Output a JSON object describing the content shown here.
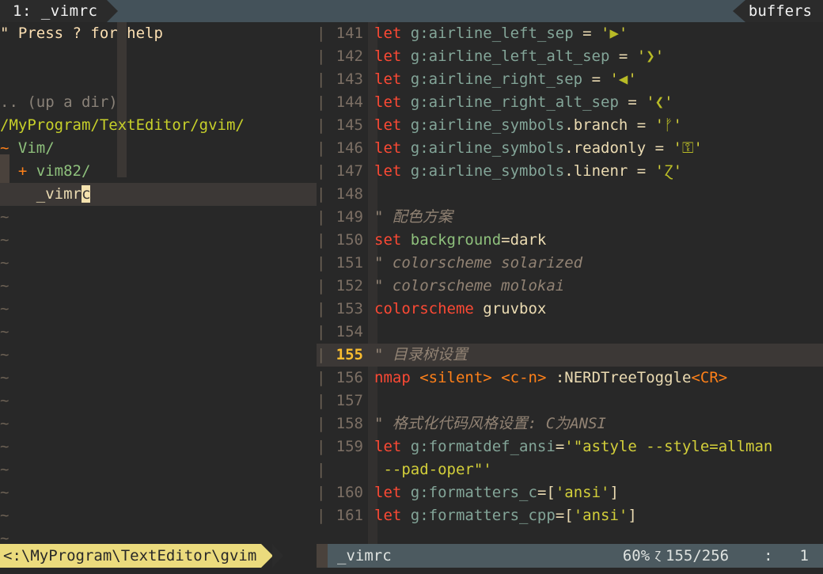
{
  "tabline": {
    "active_tab": "1: _vimrc",
    "right_label": "buffers"
  },
  "nerdtree": {
    "help_line": "\" Press ? for help",
    "blank_line": "",
    "up_dir": ".. (up a dir)",
    "root_path": "/MyProgram/TextEditor/gvim/",
    "nodes": [
      {
        "marker": "~",
        "label": " Vim/"
      },
      {
        "marker": "+",
        "label": " vim82/"
      }
    ],
    "selected_file": "_vimrc",
    "selected_file_head": "_vimr",
    "selected_file_cursor": "c",
    "tilde_char": "~",
    "tilde_count": 15
  },
  "code": {
    "separator": "|",
    "lines": [
      {
        "num": "141",
        "segments": [
          {
            "t": "let",
            "c": "kw"
          },
          {
            "t": " ",
            "c": "plain"
          },
          {
            "t": "g:airline_left_sep",
            "c": "ident"
          },
          {
            "t": " = ",
            "c": "op"
          },
          {
            "t": "'",
            "c": "str"
          },
          {
            "t": "▶",
            "c": "pglyph"
          },
          {
            "t": "'",
            "c": "str"
          }
        ]
      },
      {
        "num": "142",
        "segments": [
          {
            "t": "let",
            "c": "kw"
          },
          {
            "t": " ",
            "c": "plain"
          },
          {
            "t": "g:airline_left_alt_sep",
            "c": "ident"
          },
          {
            "t": " = ",
            "c": "op"
          },
          {
            "t": "'",
            "c": "str"
          },
          {
            "t": "❯",
            "c": "pglyph"
          },
          {
            "t": "'",
            "c": "str"
          }
        ]
      },
      {
        "num": "143",
        "segments": [
          {
            "t": "let",
            "c": "kw"
          },
          {
            "t": " ",
            "c": "plain"
          },
          {
            "t": "g:airline_right_sep",
            "c": "ident"
          },
          {
            "t": " = ",
            "c": "op"
          },
          {
            "t": "'",
            "c": "str"
          },
          {
            "t": "◀",
            "c": "pglyph"
          },
          {
            "t": "'",
            "c": "str"
          }
        ]
      },
      {
        "num": "144",
        "segments": [
          {
            "t": "let",
            "c": "kw"
          },
          {
            "t": " ",
            "c": "plain"
          },
          {
            "t": "g:airline_right_alt_sep",
            "c": "ident"
          },
          {
            "t": " = ",
            "c": "op"
          },
          {
            "t": "'",
            "c": "str"
          },
          {
            "t": "❮",
            "c": "pglyph"
          },
          {
            "t": "'",
            "c": "str"
          }
        ]
      },
      {
        "num": "145",
        "segments": [
          {
            "t": "let",
            "c": "kw"
          },
          {
            "t": " ",
            "c": "plain"
          },
          {
            "t": "g:airline_symbols",
            "c": "ident"
          },
          {
            "t": ".branch",
            "c": "plain"
          },
          {
            "t": " = ",
            "c": "op"
          },
          {
            "t": "'",
            "c": "str"
          },
          {
            "t": "ᚠ",
            "c": "pglyph"
          },
          {
            "t": "'",
            "c": "str"
          }
        ]
      },
      {
        "num": "146",
        "segments": [
          {
            "t": "let",
            "c": "kw"
          },
          {
            "t": " ",
            "c": "plain"
          },
          {
            "t": "g:airline_symbols",
            "c": "ident"
          },
          {
            "t": ".readonly",
            "c": "plain"
          },
          {
            "t": " = ",
            "c": "op"
          },
          {
            "t": "'",
            "c": "str"
          },
          {
            "t": "⚿",
            "c": "pglyph"
          },
          {
            "t": "'",
            "c": "str"
          }
        ]
      },
      {
        "num": "147",
        "segments": [
          {
            "t": "let",
            "c": "kw"
          },
          {
            "t": " ",
            "c": "plain"
          },
          {
            "t": "g:airline_symbols",
            "c": "ident"
          },
          {
            "t": ".linenr",
            "c": "plain"
          },
          {
            "t": " = ",
            "c": "op"
          },
          {
            "t": "'",
            "c": "str"
          },
          {
            "t": "Ɀ",
            "c": "pglyph"
          },
          {
            "t": "'",
            "c": "str"
          }
        ]
      },
      {
        "num": "148",
        "segments": []
      },
      {
        "num": "149",
        "segments": [
          {
            "t": "\" 配色方案",
            "c": "cmt"
          }
        ]
      },
      {
        "num": "150",
        "segments": [
          {
            "t": "set",
            "c": "kw"
          },
          {
            "t": " ",
            "c": "plain"
          },
          {
            "t": "background",
            "c": "opt"
          },
          {
            "t": "=dark",
            "c": "plain"
          }
        ]
      },
      {
        "num": "151",
        "segments": [
          {
            "t": "\" colorscheme solarized",
            "c": "cmt"
          }
        ]
      },
      {
        "num": "152",
        "segments": [
          {
            "t": "\" colorscheme molokai",
            "c": "cmt"
          }
        ]
      },
      {
        "num": "153",
        "segments": [
          {
            "t": "colorscheme",
            "c": "kw"
          },
          {
            "t": " ",
            "c": "plain"
          },
          {
            "t": "gruvbox",
            "c": "plain"
          }
        ]
      },
      {
        "num": "154",
        "segments": []
      },
      {
        "num": "155",
        "cursorline": true,
        "segments": [
          {
            "t": "\" 目录树设置",
            "c": "cmt"
          }
        ]
      },
      {
        "num": "156",
        "segments": [
          {
            "t": "nmap",
            "c": "kw-o"
          },
          {
            "t": " ",
            "c": "plain"
          },
          {
            "t": "<silent>",
            "c": "special"
          },
          {
            "t": " ",
            "c": "plain"
          },
          {
            "t": "<c-n>",
            "c": "special"
          },
          {
            "t": " ",
            "c": "plain"
          },
          {
            "t": ":NERDTreeToggle",
            "c": "plain"
          },
          {
            "t": "<CR>",
            "c": "special"
          }
        ]
      },
      {
        "num": "157",
        "segments": []
      },
      {
        "num": "158",
        "segments": [
          {
            "t": "\" 格式化代码风格设置: C为ANSI",
            "c": "cmt"
          }
        ]
      },
      {
        "num": "159",
        "segments": [
          {
            "t": "let",
            "c": "kw"
          },
          {
            "t": " ",
            "c": "plain"
          },
          {
            "t": "g:formatdef_ansi",
            "c": "ident"
          },
          {
            "t": "=",
            "c": "op"
          },
          {
            "t": "'\"astyle --style=allman",
            "c": "str"
          }
        ]
      },
      {
        "num": "",
        "wrapped": true,
        "segments": [
          {
            "t": " --pad-oper\"'",
            "c": "str"
          }
        ]
      },
      {
        "num": "160",
        "segments": [
          {
            "t": "let",
            "c": "kw"
          },
          {
            "t": " ",
            "c": "plain"
          },
          {
            "t": "g:formatters_c",
            "c": "ident"
          },
          {
            "t": "=[",
            "c": "op"
          },
          {
            "t": "'ansi'",
            "c": "str"
          },
          {
            "t": "]",
            "c": "op"
          }
        ]
      },
      {
        "num": "161",
        "segments": [
          {
            "t": "let",
            "c": "kw"
          },
          {
            "t": " ",
            "c": "plain"
          },
          {
            "t": "g:formatters_cpp",
            "c": "ident"
          },
          {
            "t": "=[",
            "c": "op"
          },
          {
            "t": "'ansi'",
            "c": "str"
          },
          {
            "t": "]",
            "c": "op"
          }
        ]
      }
    ]
  },
  "statusline": {
    "left_path": "<:\\MyProgram\\TextEditor\\gvim",
    "filename": "_vimrc",
    "percent": "60%",
    "linenr_glyph": "Ɀ",
    "position": "155/256",
    "colon": ":",
    "column": "1"
  },
  "colors": {
    "background": "#282828",
    "tabline_bg": "#44525a",
    "tab_active_bg": "#2b2b2b",
    "statusline_yellow": "#ebdb7d",
    "statusline_right_bg": "#4c5a60",
    "cursorline": "#3c3836",
    "cursor_block": "#f5e2ae",
    "keyword_red": "#fb4934",
    "string_yellow": "#d3cf3a",
    "comment_gray": "#928374",
    "ident_blue": "#83a598",
    "special_orange": "#fe8019",
    "dir_green": "#8ec07c",
    "lnum_gray": "#7c6f64",
    "lnum_cursor": "#fabd2f"
  }
}
